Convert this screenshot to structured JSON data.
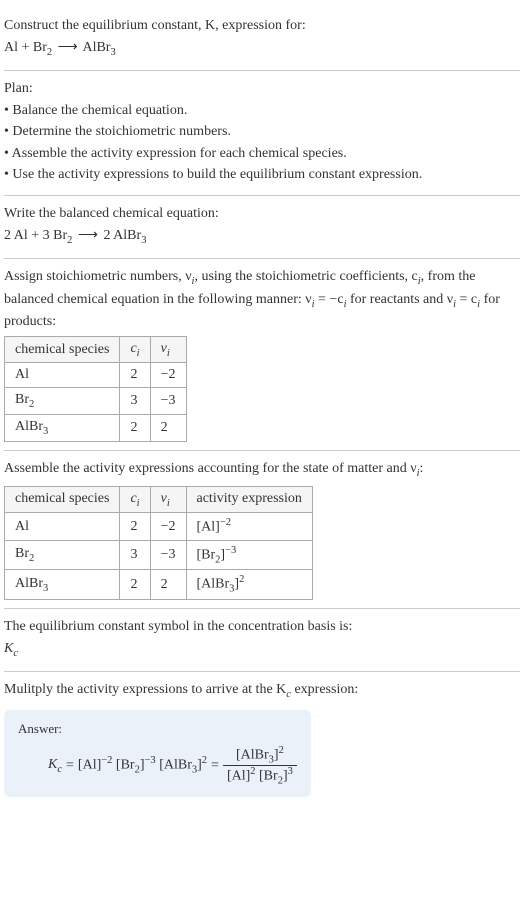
{
  "intro": {
    "line1": "Construct the equilibrium constant, K, expression for:",
    "equation_lhs": "Al + Br",
    "equation_sub1": "2",
    "equation_arrow": "⟶",
    "equation_rhs": "AlBr",
    "equation_sub2": "3"
  },
  "plan": {
    "title": "Plan:",
    "b1": "• Balance the chemical equation.",
    "b2": "• Determine the stoichiometric numbers.",
    "b3": "• Assemble the activity expression for each chemical species.",
    "b4": "• Use the activity expressions to build the equilibrium constant expression."
  },
  "balanced": {
    "title": "Write the balanced chemical equation:",
    "c1": "2 Al + 3 Br",
    "s1": "2",
    "arrow": "⟶",
    "c2": "2 AlBr",
    "s2": "3"
  },
  "stoich": {
    "text1": "Assign stoichiometric numbers, ν",
    "sub_i1": "i",
    "text2": ", using the stoichiometric coefficients, c",
    "sub_i2": "i",
    "text3": ", from the balanced chemical equation in the following manner: ν",
    "sub_i3": "i",
    "text4": " = −c",
    "sub_i4": "i",
    "text5": " for reactants and ν",
    "sub_i5": "i",
    "text6": " = c",
    "sub_i6": "i",
    "text7": " for products:",
    "headers": {
      "h1": "chemical species",
      "h2": "c",
      "h2s": "i",
      "h3": "ν",
      "h3s": "i"
    },
    "rows": [
      {
        "sp": "Al",
        "ci": "2",
        "vi": "−2"
      },
      {
        "sp": "Br",
        "sps": "2",
        "ci": "3",
        "vi": "−3"
      },
      {
        "sp": "AlBr",
        "sps": "3",
        "ci": "2",
        "vi": "2"
      }
    ]
  },
  "activity": {
    "text1": "Assemble the activity expressions accounting for the state of matter and ν",
    "sub_i": "i",
    "text2": ":",
    "headers": {
      "h1": "chemical species",
      "h2": "c",
      "h2s": "i",
      "h3": "ν",
      "h3s": "i",
      "h4": "activity expression"
    },
    "rows": [
      {
        "sp": "Al",
        "ci": "2",
        "vi": "−2",
        "ae_base": "[Al]",
        "ae_exp": "−2"
      },
      {
        "sp": "Br",
        "sps": "2",
        "ci": "3",
        "vi": "−3",
        "ae_base": "[Br",
        "ae_bsub": "2",
        "ae_close": "]",
        "ae_exp": "−3"
      },
      {
        "sp": "AlBr",
        "sps": "3",
        "ci": "2",
        "vi": "2",
        "ae_base": "[AlBr",
        "ae_bsub": "3",
        "ae_close": "]",
        "ae_exp": "2"
      }
    ]
  },
  "symbol": {
    "text": "The equilibrium constant symbol in the concentration basis is:",
    "k": "K",
    "ks": "c"
  },
  "multiply": {
    "text1": "Mulitply the activity expressions to arrive at the K",
    "sub_c": "c",
    "text2": " expression:"
  },
  "answer": {
    "label": "Answer:",
    "kc": "K",
    "kcs": "c",
    "eq": " = ",
    "t1": "[Al]",
    "t1e": "−2",
    "t2a": " [Br",
    "t2s": "2",
    "t2b": "]",
    "t2e": "−3",
    "t3a": " [AlBr",
    "t3s": "3",
    "t3b": "]",
    "t3e": "2",
    "eq2": " = ",
    "num_a": "[AlBr",
    "num_s": "3",
    "num_b": "]",
    "num_e": "2",
    "den1": "[Al]",
    "den1e": "2",
    "den2a": " [Br",
    "den2s": "2",
    "den2b": "]",
    "den2e": "3"
  }
}
